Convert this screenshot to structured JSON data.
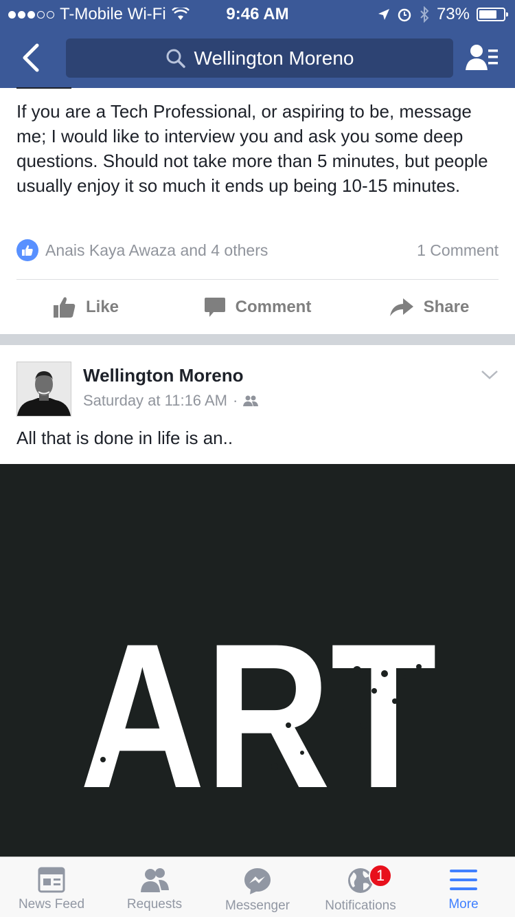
{
  "status_bar": {
    "carrier": "T-Mobile Wi-Fi",
    "time": "9:46 AM",
    "battery_percent": "73%",
    "battery_level": 0.73
  },
  "nav": {
    "search_text": "Wellington Moreno",
    "color": "#3b5998"
  },
  "post1": {
    "body": "If you are a Tech Professional, or aspiring to be, message me; I would like to interview you and ask you some deep questions. Should not take more than 5 minutes, but people usually enjoy it so much it ends up being 10-15 minutes.",
    "reactions_text": "Anais Kaya Awaza and 4 others",
    "comments_count": "1 Comment",
    "actions": {
      "like": "Like",
      "comment": "Comment",
      "share": "Share"
    }
  },
  "post2": {
    "author": "Wellington Moreno",
    "timestamp": "Saturday at 11:16 AM",
    "privacy_separator": "·",
    "text": "All that is done in life is an..",
    "image_text": "ART"
  },
  "tabbar": {
    "tabs": [
      {
        "label": "News Feed",
        "icon": "news-feed-icon"
      },
      {
        "label": "Requests",
        "icon": "friend-requests-icon"
      },
      {
        "label": "Messenger",
        "icon": "messenger-icon"
      },
      {
        "label": "Notifications",
        "icon": "globe-icon",
        "badge": "1"
      },
      {
        "label": "More",
        "icon": "menu-icon",
        "active": true
      }
    ],
    "active_color": "#4080ff"
  }
}
